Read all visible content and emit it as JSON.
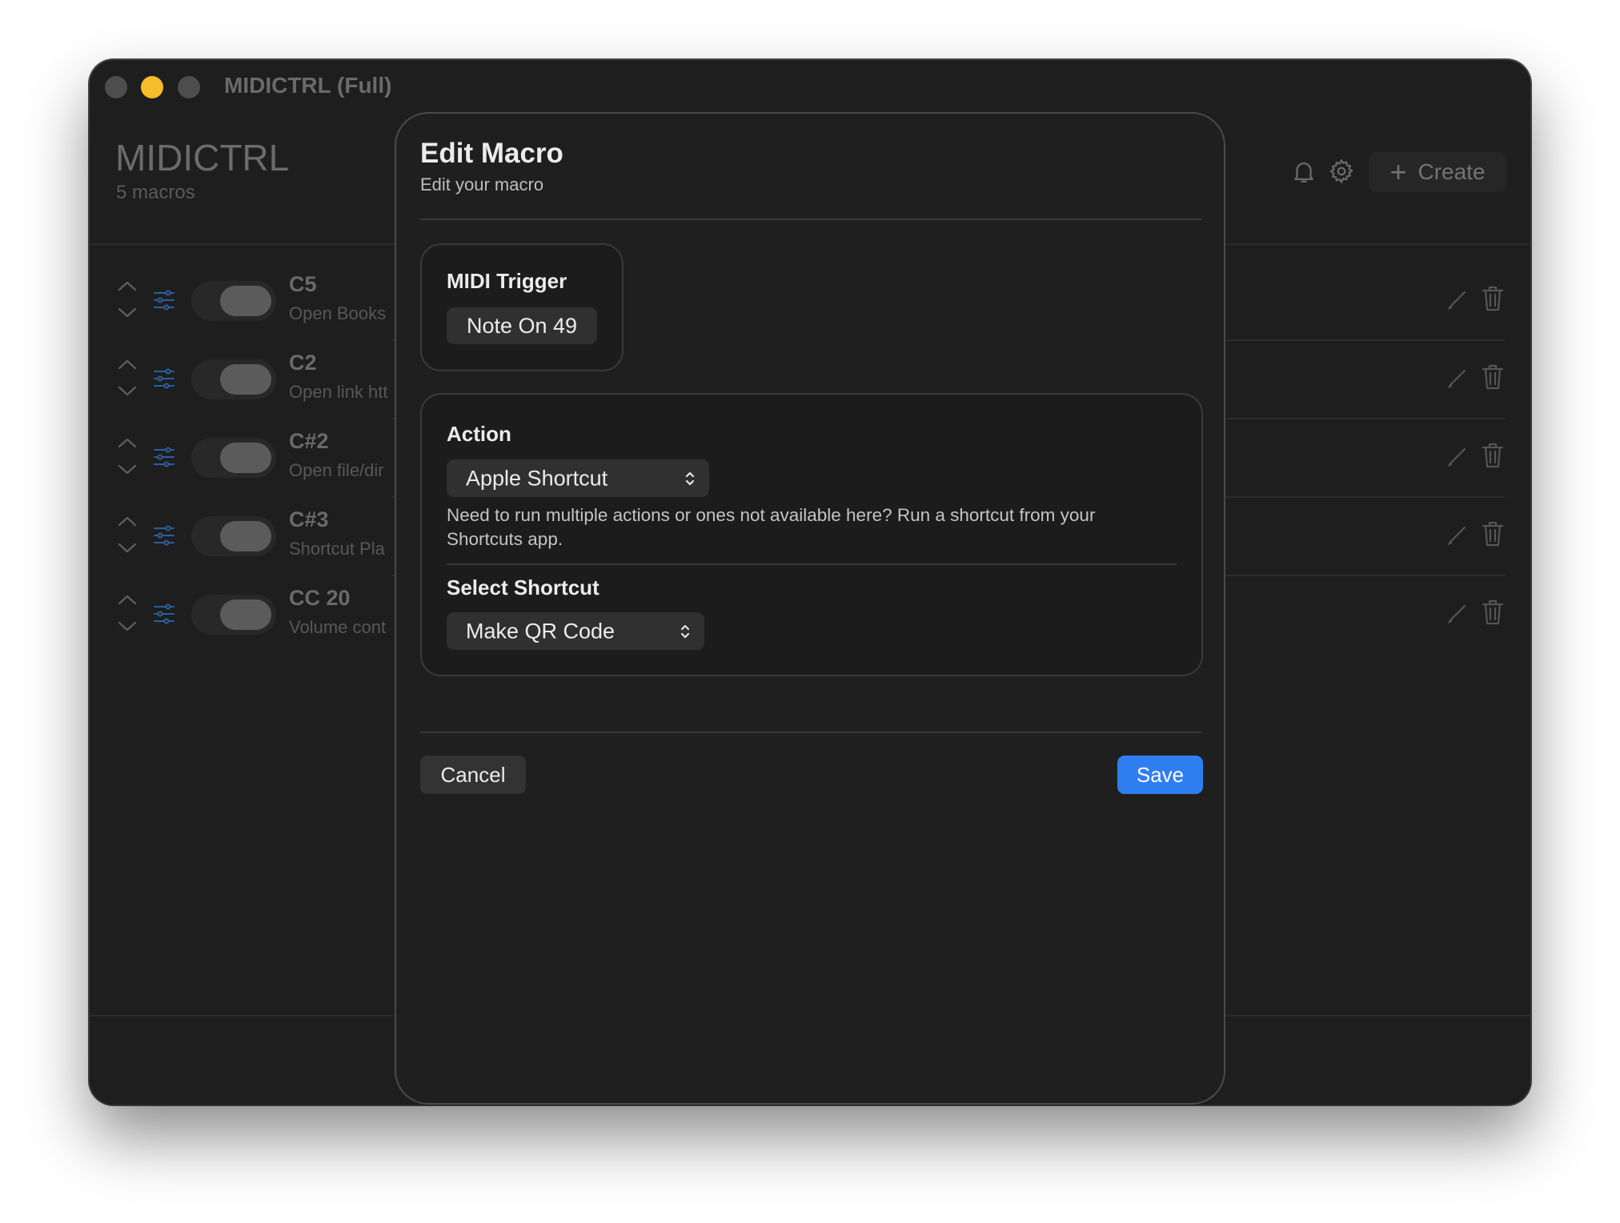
{
  "window": {
    "title": "MIDICTRL (Full)"
  },
  "header": {
    "app_title": "MIDICTRL",
    "macro_count": "5 macros",
    "bell_icon": "bell-icon",
    "settings_icon": "gear-icon",
    "create_label": "Create"
  },
  "macros": [
    {
      "note": "C5",
      "description": "Open Books"
    },
    {
      "note": "C2",
      "description": "Open link htt"
    },
    {
      "note": "C#2",
      "description": "Open file/dir"
    },
    {
      "note": "C#3",
      "description": "Shortcut Pla"
    },
    {
      "note": "CC 20",
      "description": "Volume cont"
    }
  ],
  "dialog": {
    "title": "Edit Macro",
    "subtitle": "Edit your macro",
    "trigger": {
      "label": "MIDI Trigger",
      "value": "Note On 49"
    },
    "action": {
      "label": "Action",
      "selected": "Apple Shortcut",
      "help": "Need to run multiple actions or ones not available here? Run a shortcut from your Shortcuts app."
    },
    "shortcut": {
      "label": "Select Shortcut",
      "selected": "Make QR Code"
    },
    "cancel_label": "Cancel",
    "save_label": "Save"
  },
  "colors": {
    "accent": "#2f7ef0",
    "traffic_yellow": "#f5bd2a",
    "window_bg": "#1e1e1e"
  }
}
